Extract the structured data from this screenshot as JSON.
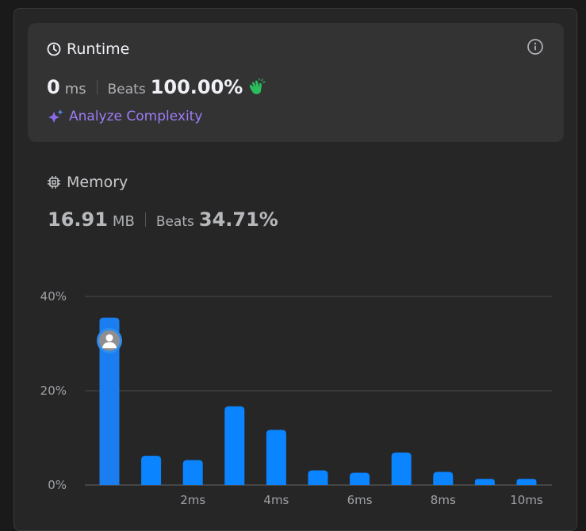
{
  "runtime": {
    "title": "Runtime",
    "value": "0",
    "unit": "ms",
    "beats_label": "Beats",
    "beats_value": "100.00%",
    "analyze_label": "Analyze Complexity"
  },
  "memory": {
    "title": "Memory",
    "value": "16.91",
    "unit": "MB",
    "beats_label": "Beats",
    "beats_value": "34.71%"
  },
  "colors": {
    "bar": "#0a84ff",
    "accent_purple": "#9d7bf4",
    "clap_green": "#2cbb5d"
  },
  "chart_data": {
    "type": "bar",
    "categories": [
      "0ms",
      "1ms",
      "2ms",
      "3ms",
      "4ms",
      "5ms",
      "6ms",
      "7ms",
      "8ms",
      "9ms",
      "10ms"
    ],
    "values": [
      35.5,
      6.2,
      5.3,
      16.7,
      11.7,
      3.1,
      2.6,
      6.9,
      2.8,
      1.3,
      1.3
    ],
    "x_tick_labels": [
      "2ms",
      "4ms",
      "6ms",
      "8ms",
      "10ms"
    ],
    "x_tick_indices": [
      2,
      4,
      6,
      8,
      10
    ],
    "y_ticks": [
      "0%",
      "20%",
      "40%"
    ],
    "y_tick_values": [
      0,
      20,
      40
    ],
    "ylim": [
      0,
      40
    ],
    "grid": true,
    "user_marker_index": 0
  }
}
